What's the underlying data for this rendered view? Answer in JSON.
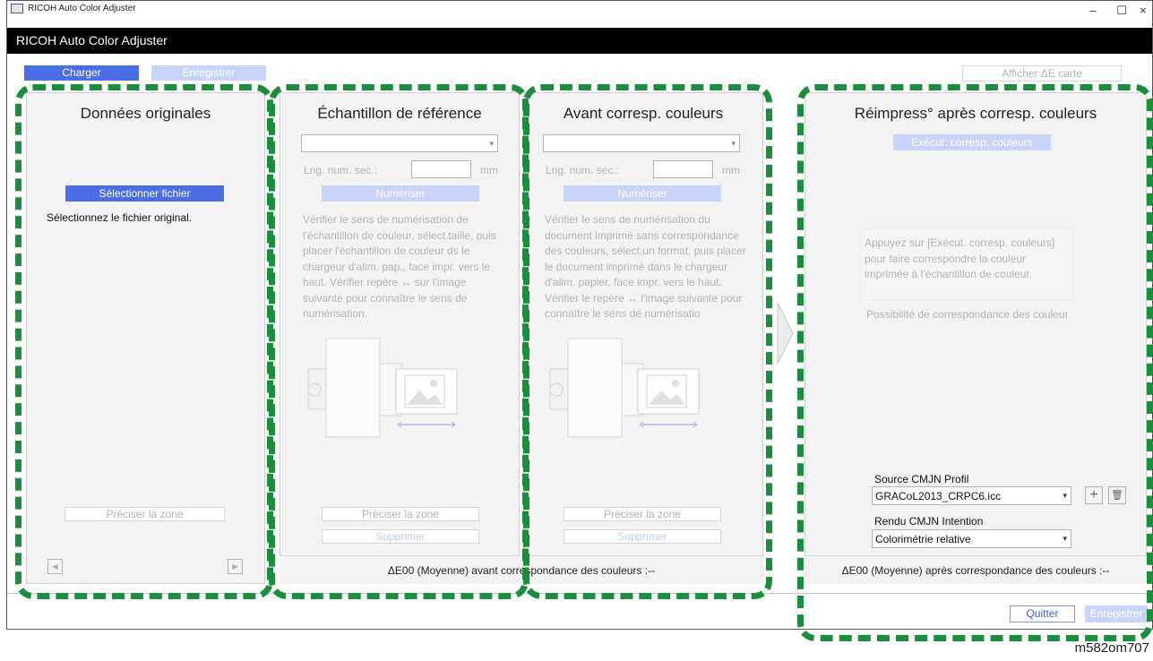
{
  "os_window": {
    "title": "RICOH Auto Color Adjuster",
    "min_symbol": "–",
    "max_symbol": "☐",
    "close_symbol": "×"
  },
  "app": {
    "title": "RICOH Auto Color Adjuster"
  },
  "toolbar": {
    "charger": "Charger",
    "enregistrer": "Enregistrer",
    "afficher": "Afficher ΔE carte"
  },
  "panel_original": {
    "title": "Données originales",
    "select_button": "Sélectionner fichier",
    "hint": "Sélectionnez le fichier original.",
    "zone_button": "Préciser la zone",
    "prev_symbol": "◀",
    "next_symbol": "▶"
  },
  "panel_reference": {
    "title": "Échantillon de référence",
    "lng_label": "Lng. num. sec.:",
    "unit": "mm",
    "scan_button": "Numériser",
    "instructions": "Vérifier le sens de numérisation de l'échantillon de couleur, sélect.taille, puis placer l'échantillon de couleur ds le chargeur d'alim. pap., face impr. vers le haut. Vérifier repère ↔ sur l'image suivante pour connaître le sens de numérisation.",
    "zone_button": "Préciser la zone",
    "delete_button": "Supprimer"
  },
  "panel_before": {
    "title": "Avant corresp. couleurs",
    "lng_label": "Lng. num. sec.:",
    "unit": "mm",
    "scan_button": "Numériser",
    "instructions": "Vérifier le sens de numérisation du document imprimé sans correspondance des couleurs, sélect.un format, puis placer le document imprimé dans le chargeur d'alim. papier, face impr. vers le haut. Vérifier le repère ↔ l'image suivante pour connaître le sens de numérisatio",
    "zone_button": "Préciser la zone",
    "delete_button": "Supprimer"
  },
  "footer_before": "ΔE00 (Moyenne) avant correspondance des couleurs :--",
  "panel_after": {
    "title": "Réimpress° après corresp. couleurs",
    "exec_button": "Exécut. corresp. couleurs",
    "info": "Appuyez sur [Exécut. corresp. couleurs] pour faire correspondre la couleur imprimée à l'échantillon de couleur.",
    "possibility": "Possibilité de correspondance des couleur",
    "source_label": "Source CMJN Profil",
    "source_value": "GRACoL2013_CRPC6.icc",
    "rendu_label": "Rendu CMJN Intention",
    "rendu_value": "Colorimétrie relative",
    "add_symbol": "+",
    "delete_symbol": "🗑",
    "footer": "ΔE00 (Moyenne) après correspondance des couleurs :--"
  },
  "bottom": {
    "quitter": "Quitter",
    "enregistrer": "Enregistrer"
  },
  "caption": "m582om707",
  "colors": {
    "accent_blue": "#4c6ee4",
    "light_blue": "#c8d4fa",
    "highlight_green": "#1b8e3e",
    "header_black": "#000000"
  }
}
